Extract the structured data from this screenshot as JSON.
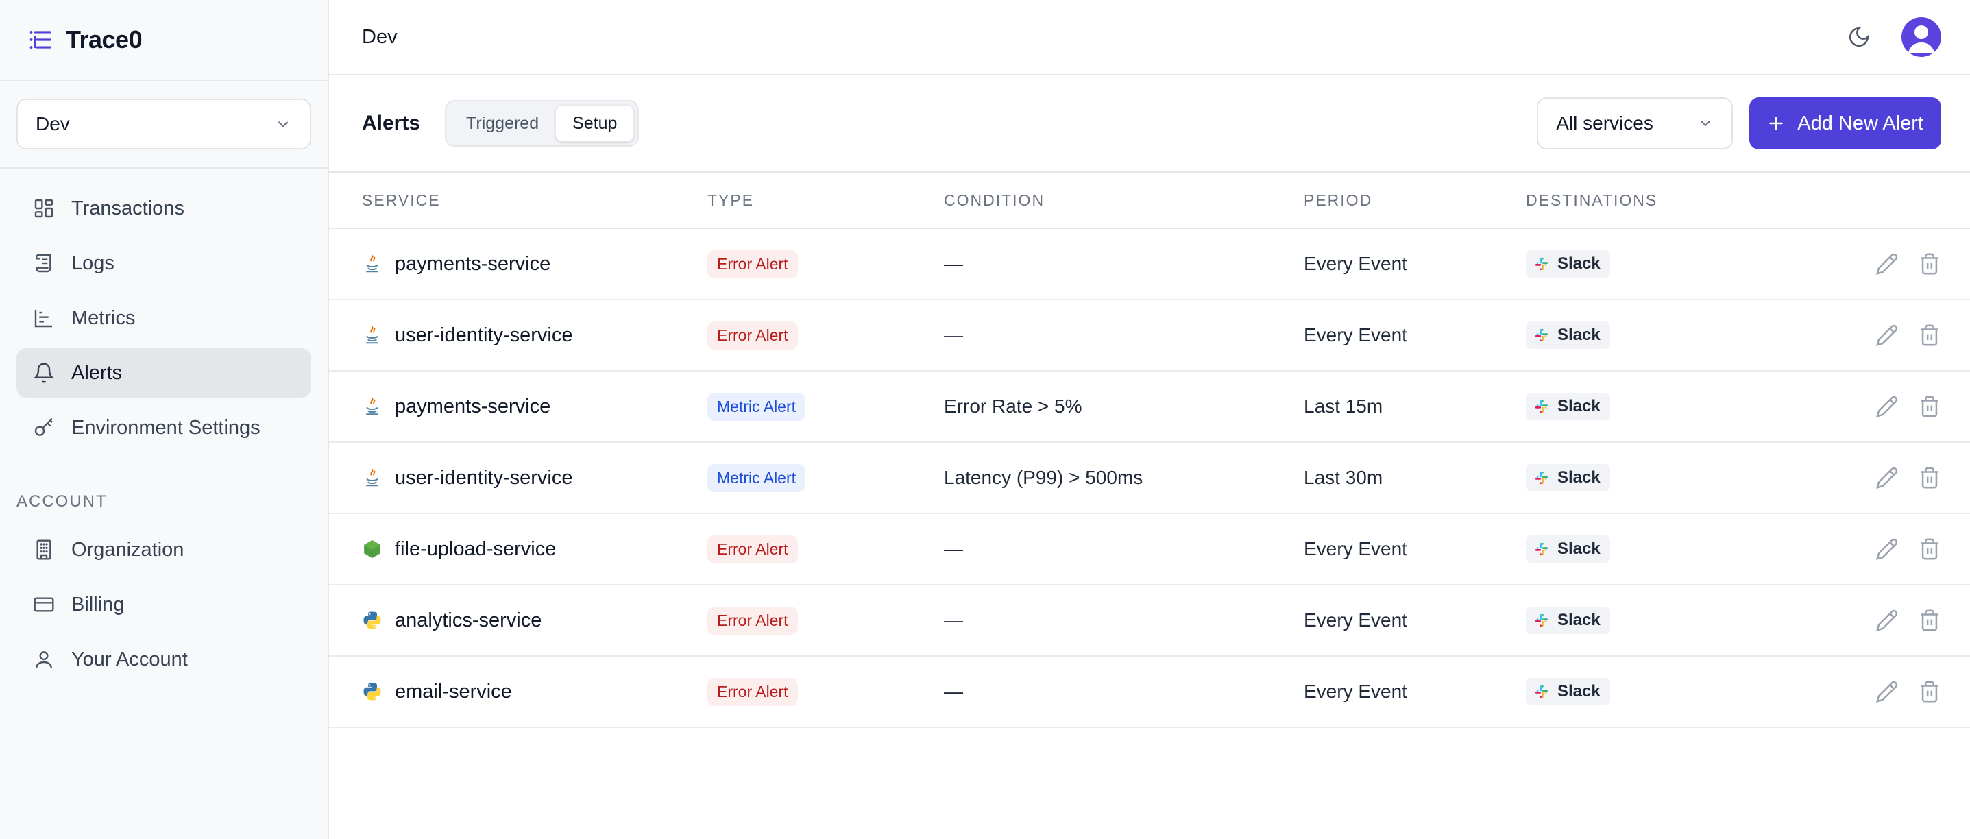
{
  "brand": {
    "name": "Trace0"
  },
  "sidebar": {
    "environment": "Dev",
    "nav": [
      {
        "label": "Transactions",
        "icon": "grid-icon"
      },
      {
        "label": "Logs",
        "icon": "scroll-icon"
      },
      {
        "label": "Metrics",
        "icon": "bar-chart-icon"
      },
      {
        "label": "Alerts",
        "icon": "bell-icon",
        "active": true
      },
      {
        "label": "Environment Settings",
        "icon": "key-icon"
      }
    ],
    "account_title": "ACCOUNT",
    "account": [
      {
        "label": "Organization",
        "icon": "building-icon"
      },
      {
        "label": "Billing",
        "icon": "credit-card-icon"
      },
      {
        "label": "Your Account",
        "icon": "user-icon"
      }
    ]
  },
  "header": {
    "title": "Dev"
  },
  "toolbar": {
    "title": "Alerts",
    "tabs": [
      "Triggered",
      "Setup"
    ],
    "active_tab": "Setup",
    "service_filter": "All services",
    "add_label": "Add New Alert"
  },
  "table": {
    "columns": [
      "SERVICE",
      "TYPE",
      "CONDITION",
      "PERIOD",
      "DESTINATIONS"
    ],
    "rows": [
      {
        "service": "payments-service",
        "runtime": "java",
        "type": "Error Alert",
        "kind": "error",
        "condition": "—",
        "period": "Every Event",
        "destination": "Slack"
      },
      {
        "service": "user-identity-service",
        "runtime": "java",
        "type": "Error Alert",
        "kind": "error",
        "condition": "—",
        "period": "Every Event",
        "destination": "Slack"
      },
      {
        "service": "payments-service",
        "runtime": "java",
        "type": "Metric Alert",
        "kind": "metric",
        "condition": "Error Rate > 5%",
        "period": "Last 15m",
        "destination": "Slack"
      },
      {
        "service": "user-identity-service",
        "runtime": "java",
        "type": "Metric Alert",
        "kind": "metric",
        "condition": "Latency (P99) > 500ms",
        "period": "Last 30m",
        "destination": "Slack"
      },
      {
        "service": "file-upload-service",
        "runtime": "node",
        "type": "Error Alert",
        "kind": "error",
        "condition": "—",
        "period": "Every Event",
        "destination": "Slack"
      },
      {
        "service": "analytics-service",
        "runtime": "python",
        "type": "Error Alert",
        "kind": "error",
        "condition": "—",
        "period": "Every Event",
        "destination": "Slack"
      },
      {
        "service": "email-service",
        "runtime": "python",
        "type": "Error Alert",
        "kind": "error",
        "condition": "—",
        "period": "Every Event",
        "destination": "Slack"
      }
    ]
  },
  "colors": {
    "accent": "#4f40d9",
    "error_text": "#b91c1c",
    "metric_text": "#1d4ed8"
  }
}
